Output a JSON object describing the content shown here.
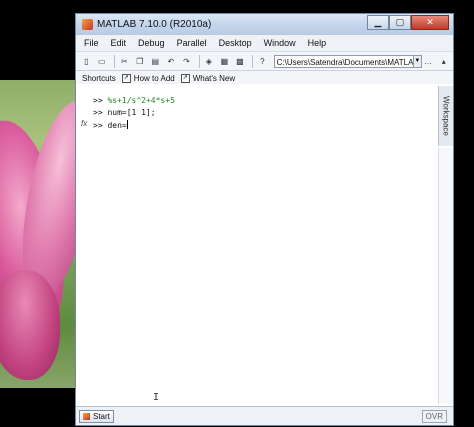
{
  "window": {
    "title": "MATLAB  7.10.0 (R2010a)",
    "minimize": "▁",
    "maximize": "▢",
    "close": "✕"
  },
  "menubar": [
    "File",
    "Edit",
    "Debug",
    "Parallel",
    "Desktop",
    "Window",
    "Help"
  ],
  "toolbar": {
    "current_directory": "C:\\Users\\Satendra\\Documents\\MATLAB",
    "dropdown_glyph": "▼",
    "browse_glyph": "…"
  },
  "shortcuts": {
    "shortcuts_label": "Shortcuts",
    "how_to_add_label": "How to Add",
    "whats_new_label": "What's New"
  },
  "command_window": {
    "fx_label": "fx",
    "lines": [
      {
        "prompt": ">> ",
        "text": "%s+1/s^2+4*s+5"
      },
      {
        "prompt": ">> ",
        "text": "num=[1 1];"
      },
      {
        "prompt": ">> ",
        "text": "den="
      }
    ]
  },
  "workspace_tab": "Workspace",
  "statusbar": {
    "start_label": "Start",
    "ovr_label": "OVR"
  },
  "colors": {
    "comment": "#228b22",
    "window_frame": "#c9d8ea",
    "close_button": "#c0392b"
  }
}
